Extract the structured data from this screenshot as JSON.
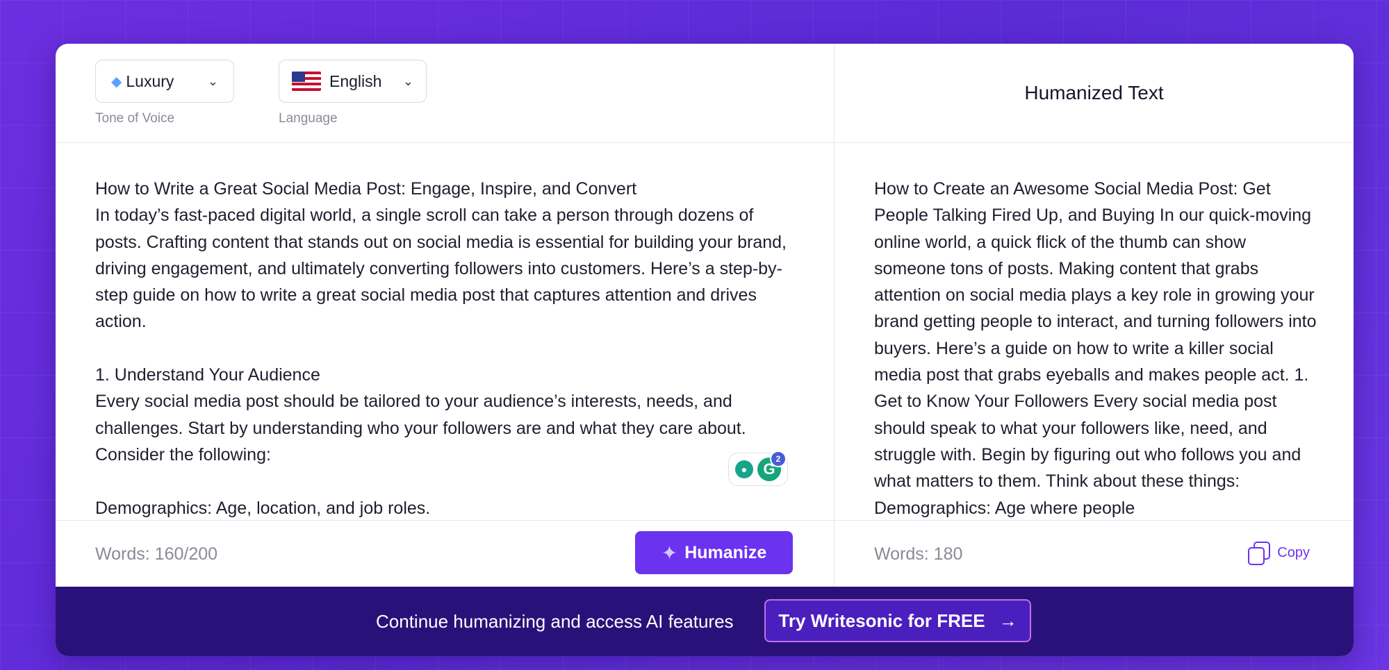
{
  "tone": {
    "icon": "gem-icon",
    "value": "Luxury",
    "label": "Tone of Voice"
  },
  "language": {
    "icon": "us-flag-icon",
    "value": "English",
    "label": "Language"
  },
  "input": {
    "text": "How to Write a Great Social Media Post: Engage, Inspire, and Convert\nIn today’s fast-paced digital world, a single scroll can take a person through dozens of posts. Crafting content that stands out on social media is essential for building your brand, driving engagement, and ultimately converting followers into customers. Here’s a step-by-step guide on how to write a great social media post that captures attention and drives action.\n\n1. Understand Your Audience\nEvery social media post should be tailored to your audience’s interests, needs, and challenges. Start by understanding who your followers are and what they care about. Consider the following:\n\nDemographics: Age, location, and job roles.",
    "word_count": "Words: 160/200",
    "humanize_label": "Humanize"
  },
  "output": {
    "title": "Humanized Text",
    "text": "How to Create an Awesome Social Media Post: Get People Talking Fired Up, and Buying In our quick-moving online world, a quick flick of the thumb can show someone tons of posts. Making content that grabs attention on social media plays a key role in growing your brand getting people to interact, and turning followers into buyers. Here’s a guide on how to write a killer social media post that grabs eyeballs and makes people act. 1. Get to Know Your Followers Every social media post should speak to what your followers like, need, and struggle with. Begin by figuring out who follows you and what matters to them. Think about these things: Demographics: Age where people",
    "word_count": "Words: 180",
    "copy_label": "Copy"
  },
  "grammarly": {
    "badge_count": "2",
    "g_letter": "G",
    "bulb_icon": "lightbulb-icon"
  },
  "banner": {
    "text": "Continue humanizing and access AI features",
    "cta_label": "Try Writesonic for FREE",
    "cta_arrow": "→"
  },
  "colors": {
    "accent": "#6b32f0",
    "banner_bg": "#2a117a",
    "background": "#5b2bd6"
  }
}
